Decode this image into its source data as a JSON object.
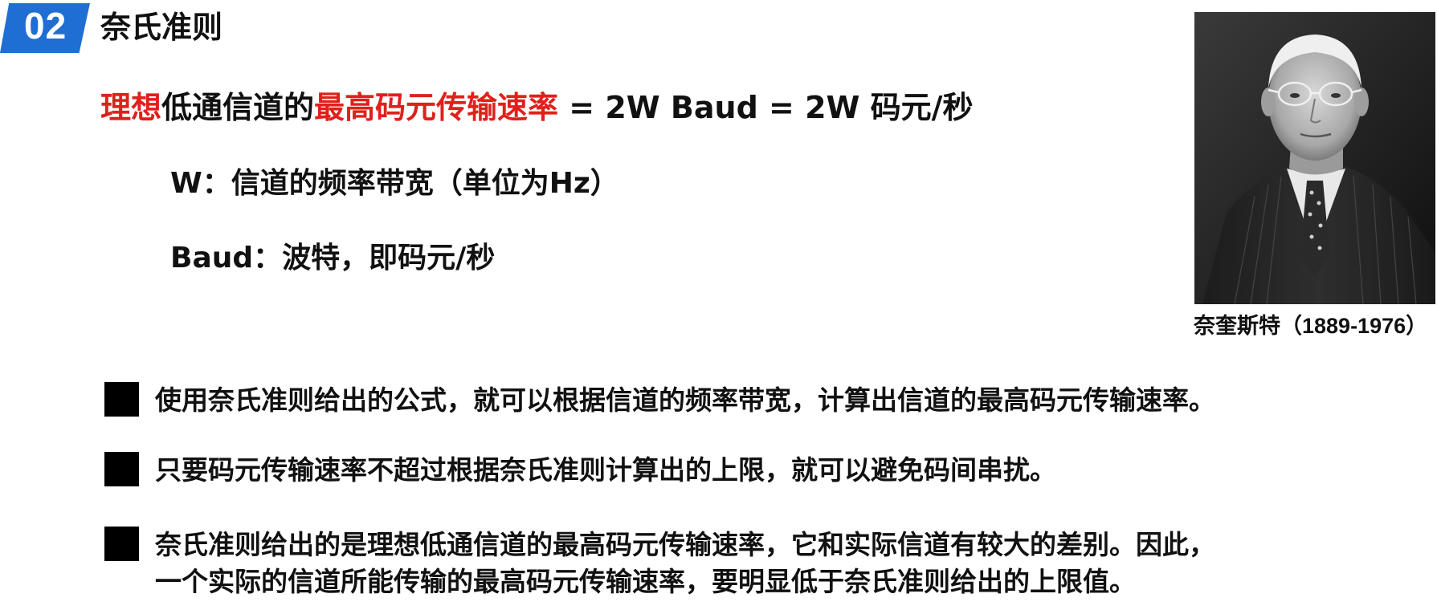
{
  "header": {
    "section_number": "02",
    "section_title": "奈氏准则",
    "badge_color": "#1f6ed4"
  },
  "formula": {
    "part1": "理想",
    "part2": "低通信道的",
    "part3": "最高码元传输速率",
    "part4": " = 2W Baud = 2W 码元/秒",
    "highlight_color": "#e0201c"
  },
  "definitions": {
    "w": "W：信道的频率带宽（单位为Hz）",
    "baud": "Baud：波特，即码元/秒"
  },
  "portrait": {
    "icon": "person-photo",
    "caption": "奈奎斯特（1889-1976）"
  },
  "bullets": [
    {
      "text": "使用奈氏准则给出的公式，就可以根据信道的频率带宽，计算出信道的最高码元传输速率。"
    },
    {
      "text": "只要码元传输速率不超过根据奈氏准则计算出的上限，就可以避免码间串扰。"
    },
    {
      "line1": "奈氏准则给出的是理想低通信道的最高码元传输速率，它和实际信道有较大的差别。因此，",
      "line2": "一个实际的信道所能传输的最高码元传输速率，要明显低于奈氏准则给出的上限值。"
    }
  ]
}
